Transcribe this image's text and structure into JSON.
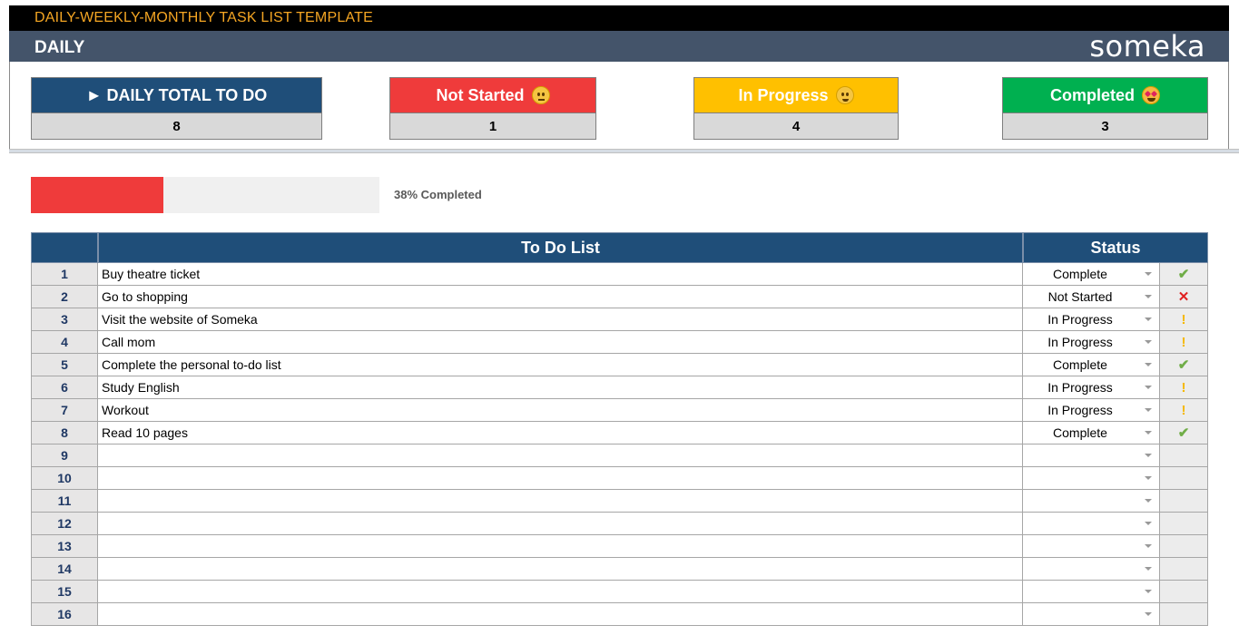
{
  "header": {
    "title": "DAILY-WEEKLY-MONTHLY TASK LIST TEMPLATE",
    "section": "DAILY",
    "logo": "someka"
  },
  "cards": [
    {
      "label": "► DAILY TOTAL TO DO",
      "value": "8",
      "color": "#1f4e79",
      "emoji": ""
    },
    {
      "label": "Not Started",
      "value": "1",
      "color": "#ef3b3b",
      "emoji": "neutral-face-icon"
    },
    {
      "label": "In Progress",
      "value": "4",
      "color": "#ffc000",
      "emoji": "smile-face-icon"
    },
    {
      "label": "Completed",
      "value": "3",
      "color": "#00b050",
      "emoji": "star-struck-face-icon"
    }
  ],
  "progress": {
    "fraction": 0.38,
    "label": "38% Completed",
    "color": "#ef3b3b"
  },
  "table": {
    "headers": {
      "number": "",
      "task": "To Do List",
      "status": "Status"
    },
    "rows": [
      {
        "num": "1",
        "task": "Buy theatre ticket",
        "status": "Complete",
        "icon": "✔",
        "icon_type": "check"
      },
      {
        "num": "2",
        "task": "Go to shopping",
        "status": "Not Started",
        "icon": "✕",
        "icon_type": "x"
      },
      {
        "num": "3",
        "task": "Visit the website of Someka",
        "status": "In Progress",
        "icon": "!",
        "icon_type": "warn"
      },
      {
        "num": "4",
        "task": "Call mom",
        "status": "In Progress",
        "icon": "!",
        "icon_type": "warn"
      },
      {
        "num": "5",
        "task": "Complete the personal to-do list",
        "status": "Complete",
        "icon": "✔",
        "icon_type": "check"
      },
      {
        "num": "6",
        "task": "Study English",
        "status": "In Progress",
        "icon": "!",
        "icon_type": "warn"
      },
      {
        "num": "7",
        "task": "Workout",
        "status": "In Progress",
        "icon": "!",
        "icon_type": "warn"
      },
      {
        "num": "8",
        "task": "Read 10 pages",
        "status": "Complete",
        "icon": "✔",
        "icon_type": "check"
      },
      {
        "num": "9",
        "task": "",
        "status": "",
        "icon": "",
        "icon_type": ""
      },
      {
        "num": "10",
        "task": "",
        "status": "",
        "icon": "",
        "icon_type": ""
      },
      {
        "num": "11",
        "task": "",
        "status": "",
        "icon": "",
        "icon_type": ""
      },
      {
        "num": "12",
        "task": "",
        "status": "",
        "icon": "",
        "icon_type": ""
      },
      {
        "num": "13",
        "task": "",
        "status": "",
        "icon": "",
        "icon_type": ""
      },
      {
        "num": "14",
        "task": "",
        "status": "",
        "icon": "",
        "icon_type": ""
      },
      {
        "num": "15",
        "task": "",
        "status": "",
        "icon": "",
        "icon_type": ""
      },
      {
        "num": "16",
        "task": "",
        "status": "",
        "icon": "",
        "icon_type": ""
      }
    ]
  }
}
